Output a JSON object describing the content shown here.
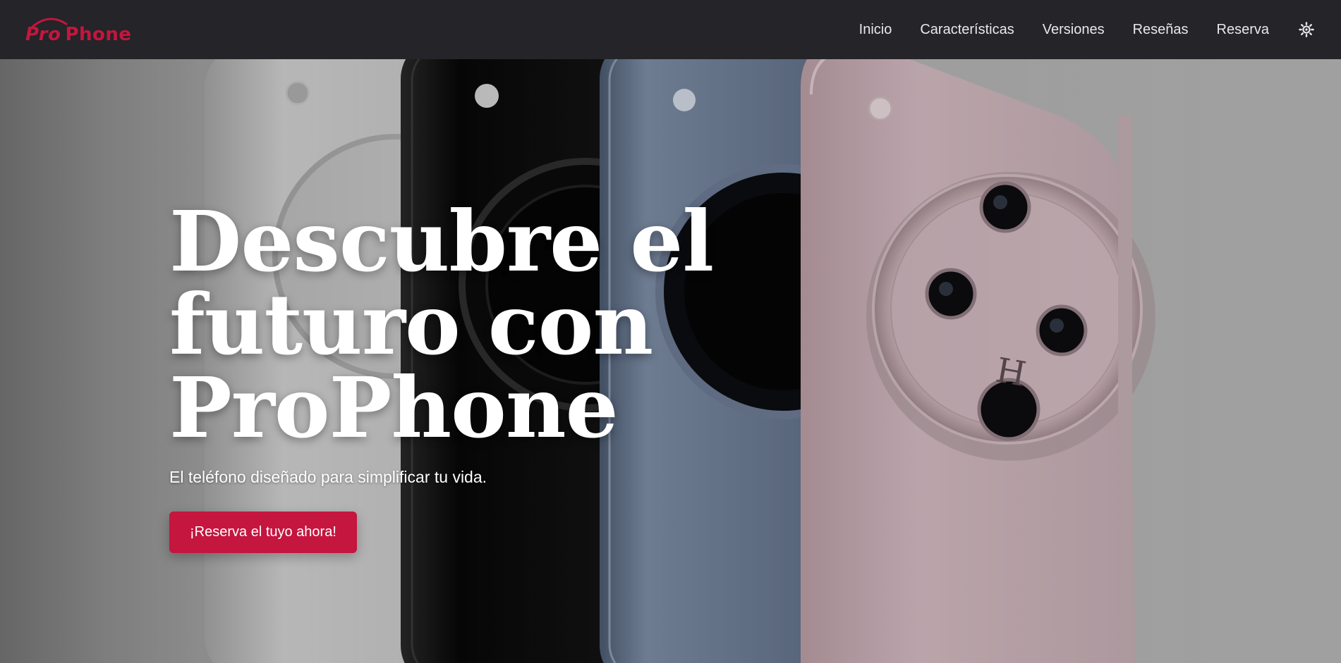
{
  "brand": {
    "pro": "Pro",
    "phone": "Phone",
    "accent_color": "#c4163e"
  },
  "nav": {
    "links": [
      {
        "label": "Inicio"
      },
      {
        "label": "Características"
      },
      {
        "label": "Versiones"
      },
      {
        "label": "Reseñas"
      },
      {
        "label": "Reserva"
      }
    ],
    "theme_toggle_icon": "sun-icon"
  },
  "hero": {
    "title": "Descubre el futuro con ProPhone",
    "subtitle": "El teléfono diseñado para simplificar tu vida.",
    "cta_label": "¡Reserva el tuyo ahora!",
    "background_image": "phones-lineup-image",
    "phone_colors": [
      "#e6e6e6",
      "#111111",
      "#5f6f86",
      "#c9b3ba"
    ]
  }
}
